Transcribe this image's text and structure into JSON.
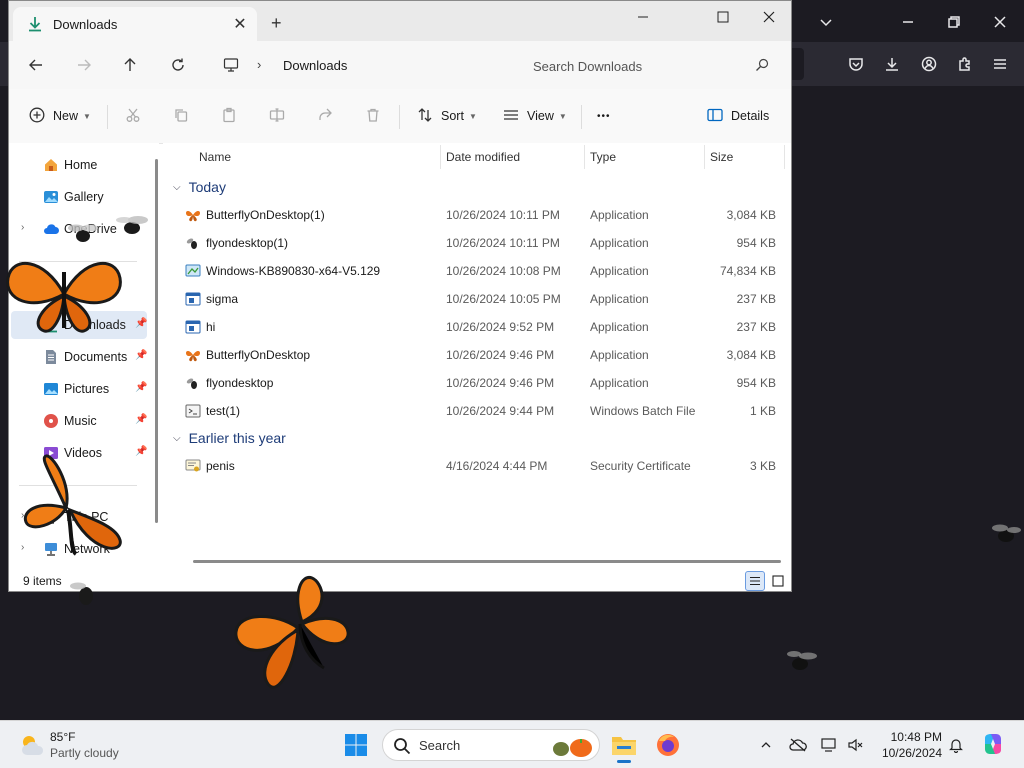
{
  "explorer": {
    "tab_title": "Downloads",
    "tab_close": "✕",
    "new_tab": "+",
    "window_controls": {
      "minimize": "—",
      "maximize": "☐",
      "close": "✕"
    },
    "breadcrumb": {
      "separator": "›",
      "current": "Downloads"
    },
    "search_placeholder": "Search Downloads",
    "commands": {
      "new": "New",
      "sort": "Sort",
      "view": "View",
      "more": "•••",
      "details": "Details"
    },
    "navigation": {
      "items": [
        {
          "label": "Home",
          "icon": "home-icon"
        },
        {
          "label": "Gallery",
          "icon": "gallery-icon"
        },
        {
          "label": "OneDrive",
          "icon": "onedrive-icon",
          "expandable": true
        },
        {
          "label": "Downloads",
          "icon": "downloads-icon",
          "pinned": true,
          "selected": true
        },
        {
          "label": "Documents",
          "icon": "documents-icon",
          "pinned": true
        },
        {
          "label": "Pictures",
          "icon": "pictures-icon",
          "pinned": true
        },
        {
          "label": "Music",
          "icon": "music-icon",
          "pinned": true
        },
        {
          "label": "Videos",
          "icon": "videos-icon",
          "pinned": true
        },
        {
          "label": "This PC",
          "icon": "this-pc-icon",
          "expandable": true
        },
        {
          "label": "Network",
          "icon": "network-icon",
          "expandable": true
        }
      ],
      "pin_glyph": "📌",
      "expand_glyph": "›"
    },
    "columns": {
      "name": "Name",
      "date": "Date modified",
      "type": "Type",
      "size": "Size"
    },
    "groups": [
      {
        "label": "Today",
        "files": [
          {
            "name": "ButterflyOnDesktop(1)",
            "date": "10/26/2024 10:11 PM",
            "type": "Application",
            "size": "3,084 KB",
            "icon": "butterfly-app-icon"
          },
          {
            "name": "flyondesktop(1)",
            "date": "10/26/2024 10:11 PM",
            "type": "Application",
            "size": "954 KB",
            "icon": "fly-app-icon"
          },
          {
            "name": "Windows-KB890830-x64-V5.129",
            "date": "10/26/2024 10:08 PM",
            "type": "Application",
            "size": "74,834 KB",
            "icon": "installer-app-icon"
          },
          {
            "name": "sigma",
            "date": "10/26/2024 10:05 PM",
            "type": "Application",
            "size": "237 KB",
            "icon": "window-app-icon"
          },
          {
            "name": "hi",
            "date": "10/26/2024 9:52 PM",
            "type": "Application",
            "size": "237 KB",
            "icon": "window-app-icon"
          },
          {
            "name": "ButterflyOnDesktop",
            "date": "10/26/2024 9:46 PM",
            "type": "Application",
            "size": "3,084 KB",
            "icon": "butterfly-app-icon"
          },
          {
            "name": "flyondesktop",
            "date": "10/26/2024 9:46 PM",
            "type": "Application",
            "size": "954 KB",
            "icon": "fly-app-icon"
          },
          {
            "name": "test(1)",
            "date": "10/26/2024 9:44 PM",
            "type": "Windows Batch File",
            "size": "1 KB",
            "icon": "batch-file-icon"
          }
        ]
      },
      {
        "label": "Earlier this year",
        "files": [
          {
            "name": "penis",
            "date": "4/16/2024 4:44 PM",
            "type": "Security Certificate",
            "size": "3 KB",
            "icon": "certificate-icon"
          }
        ]
      }
    ],
    "status": "9 items"
  },
  "taskbar": {
    "weather_temp": "85°F",
    "weather_desc": "Partly cloudy",
    "search_label": "Search",
    "clock_time": "10:48 PM",
    "clock_date": "10/26/2024"
  },
  "colors": {
    "accent": "#0067c0",
    "selection": "#e0e9f5",
    "group_header": "#1e3c78",
    "browser_bg": "#1c1b22"
  }
}
